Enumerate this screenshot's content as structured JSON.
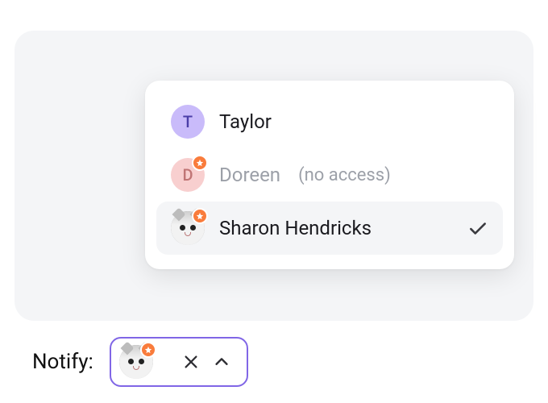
{
  "notify": {
    "label": "Notify:",
    "chip": {
      "avatar_type": "cat",
      "has_star": true
    }
  },
  "dropdown": {
    "options": [
      {
        "name": "Taylor",
        "avatar_letter": "T",
        "avatar_color": "purple",
        "has_star": false,
        "annotation": "",
        "disabled": false,
        "selected": false
      },
      {
        "name": "Doreen",
        "avatar_letter": "D",
        "avatar_color": "pink",
        "has_star": true,
        "annotation": "(no access)",
        "disabled": true,
        "selected": false
      },
      {
        "name": "Sharon Hendricks",
        "avatar_type": "cat",
        "has_star": true,
        "annotation": "",
        "disabled": false,
        "selected": true
      }
    ]
  }
}
